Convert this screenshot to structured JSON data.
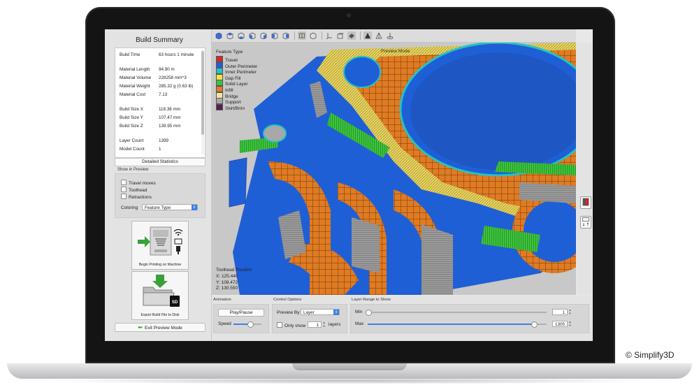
{
  "copyright": "© Simplify3D",
  "build_summary": {
    "title": "Build Summary",
    "rows": [
      {
        "label": "Build Time",
        "value": "63 hours 1 minute"
      },
      {
        "label": "Material Length",
        "value": "94.90 m"
      },
      {
        "label": "Material Volume",
        "value": "228258 mm^3"
      },
      {
        "label": "Material Weight",
        "value": "285.32 g (0.63 lb)"
      },
      {
        "label": "Material Cost",
        "value": "7.13"
      },
      {
        "label": "Build Size X",
        "value": "118.36 mm"
      },
      {
        "label": "Build Size Y",
        "value": "107.47 mm"
      },
      {
        "label": "Build Size Z",
        "value": "139.95 mm"
      },
      {
        "label": "Layer Count",
        "value": "1399"
      },
      {
        "label": "Model Count",
        "value": "1"
      }
    ],
    "detailed_button": "Detailed Statistics"
  },
  "show_in_preview": {
    "title": "Show in Preview",
    "options": [
      "Travel moves",
      "Toolhead",
      "Retractions"
    ],
    "coloring_label": "Coloring",
    "coloring_value": "Feature Type"
  },
  "actions": {
    "print_label": "Begin Printing on Machine",
    "export_label": "Export Build File to Disk",
    "sd_label": "SD",
    "exit_label": "Exit Preview Mode"
  },
  "viewport": {
    "preview_mode": "Preview Mode",
    "legend_title": "Feature Type",
    "legend": [
      {
        "label": "Travel",
        "color": "#d62728"
      },
      {
        "label": "Outer Perimeter",
        "color": "#1f5fd6"
      },
      {
        "label": "Inner Perimeter",
        "color": "#22c4c4"
      },
      {
        "label": "Gap Fill",
        "color": "#f0e442"
      },
      {
        "label": "Solid Layer",
        "color": "#3cc43c"
      },
      {
        "label": "Infill",
        "color": "#e07b22"
      },
      {
        "label": "Bridge",
        "color": "#f2e4a0"
      },
      {
        "label": "Support",
        "color": "#a8a8a8"
      },
      {
        "label": "Skirt/Brim",
        "color": "#5a1f4a"
      }
    ],
    "toolhead_title": "Toolhead Position",
    "toolhead_x": "X: 125.440",
    "toolhead_y": "Y: 108.472",
    "toolhead_z": "Z: 130.550"
  },
  "animation": {
    "title": "Animation",
    "play_label": "Play/Pause",
    "speed_label": "Speed",
    "speed_level": 0.6
  },
  "control_options": {
    "title": "Control Options",
    "preview_by_label": "Preview By",
    "preview_by_value": "Layer",
    "only_show_label": "Only show",
    "only_show_value": "1",
    "layers_label": "layers"
  },
  "layer_range": {
    "title": "Layer Range to Show",
    "min_label": "Min",
    "min_value": "1",
    "max_label": "Max",
    "max_value": "1305",
    "max_level": 0.93
  }
}
